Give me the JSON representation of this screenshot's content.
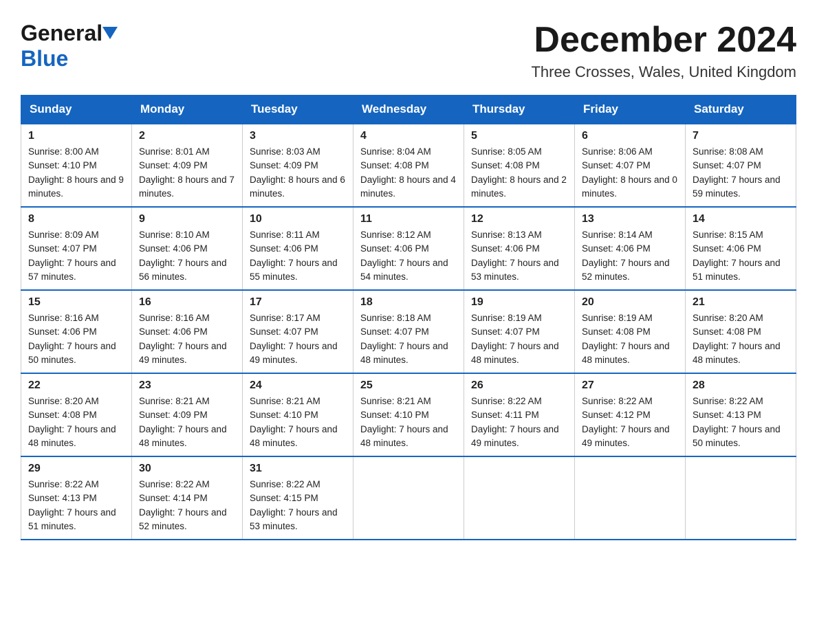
{
  "header": {
    "logo_general": "General",
    "logo_blue": "Blue",
    "month_title": "December 2024",
    "location": "Three Crosses, Wales, United Kingdom"
  },
  "days_of_week": [
    "Sunday",
    "Monday",
    "Tuesday",
    "Wednesday",
    "Thursday",
    "Friday",
    "Saturday"
  ],
  "weeks": [
    [
      {
        "day": "1",
        "sunrise": "8:00 AM",
        "sunset": "4:10 PM",
        "daylight": "8 hours and 9 minutes."
      },
      {
        "day": "2",
        "sunrise": "8:01 AM",
        "sunset": "4:09 PM",
        "daylight": "8 hours and 7 minutes."
      },
      {
        "day": "3",
        "sunrise": "8:03 AM",
        "sunset": "4:09 PM",
        "daylight": "8 hours and 6 minutes."
      },
      {
        "day": "4",
        "sunrise": "8:04 AM",
        "sunset": "4:08 PM",
        "daylight": "8 hours and 4 minutes."
      },
      {
        "day": "5",
        "sunrise": "8:05 AM",
        "sunset": "4:08 PM",
        "daylight": "8 hours and 2 minutes."
      },
      {
        "day": "6",
        "sunrise": "8:06 AM",
        "sunset": "4:07 PM",
        "daylight": "8 hours and 0 minutes."
      },
      {
        "day": "7",
        "sunrise": "8:08 AM",
        "sunset": "4:07 PM",
        "daylight": "7 hours and 59 minutes."
      }
    ],
    [
      {
        "day": "8",
        "sunrise": "8:09 AM",
        "sunset": "4:07 PM",
        "daylight": "7 hours and 57 minutes."
      },
      {
        "day": "9",
        "sunrise": "8:10 AM",
        "sunset": "4:06 PM",
        "daylight": "7 hours and 56 minutes."
      },
      {
        "day": "10",
        "sunrise": "8:11 AM",
        "sunset": "4:06 PM",
        "daylight": "7 hours and 55 minutes."
      },
      {
        "day": "11",
        "sunrise": "8:12 AM",
        "sunset": "4:06 PM",
        "daylight": "7 hours and 54 minutes."
      },
      {
        "day": "12",
        "sunrise": "8:13 AM",
        "sunset": "4:06 PM",
        "daylight": "7 hours and 53 minutes."
      },
      {
        "day": "13",
        "sunrise": "8:14 AM",
        "sunset": "4:06 PM",
        "daylight": "7 hours and 52 minutes."
      },
      {
        "day": "14",
        "sunrise": "8:15 AM",
        "sunset": "4:06 PM",
        "daylight": "7 hours and 51 minutes."
      }
    ],
    [
      {
        "day": "15",
        "sunrise": "8:16 AM",
        "sunset": "4:06 PM",
        "daylight": "7 hours and 50 minutes."
      },
      {
        "day": "16",
        "sunrise": "8:16 AM",
        "sunset": "4:06 PM",
        "daylight": "7 hours and 49 minutes."
      },
      {
        "day": "17",
        "sunrise": "8:17 AM",
        "sunset": "4:07 PM",
        "daylight": "7 hours and 49 minutes."
      },
      {
        "day": "18",
        "sunrise": "8:18 AM",
        "sunset": "4:07 PM",
        "daylight": "7 hours and 48 minutes."
      },
      {
        "day": "19",
        "sunrise": "8:19 AM",
        "sunset": "4:07 PM",
        "daylight": "7 hours and 48 minutes."
      },
      {
        "day": "20",
        "sunrise": "8:19 AM",
        "sunset": "4:08 PM",
        "daylight": "7 hours and 48 minutes."
      },
      {
        "day": "21",
        "sunrise": "8:20 AM",
        "sunset": "4:08 PM",
        "daylight": "7 hours and 48 minutes."
      }
    ],
    [
      {
        "day": "22",
        "sunrise": "8:20 AM",
        "sunset": "4:08 PM",
        "daylight": "7 hours and 48 minutes."
      },
      {
        "day": "23",
        "sunrise": "8:21 AM",
        "sunset": "4:09 PM",
        "daylight": "7 hours and 48 minutes."
      },
      {
        "day": "24",
        "sunrise": "8:21 AM",
        "sunset": "4:10 PM",
        "daylight": "7 hours and 48 minutes."
      },
      {
        "day": "25",
        "sunrise": "8:21 AM",
        "sunset": "4:10 PM",
        "daylight": "7 hours and 48 minutes."
      },
      {
        "day": "26",
        "sunrise": "8:22 AM",
        "sunset": "4:11 PM",
        "daylight": "7 hours and 49 minutes."
      },
      {
        "day": "27",
        "sunrise": "8:22 AM",
        "sunset": "4:12 PM",
        "daylight": "7 hours and 49 minutes."
      },
      {
        "day": "28",
        "sunrise": "8:22 AM",
        "sunset": "4:13 PM",
        "daylight": "7 hours and 50 minutes."
      }
    ],
    [
      {
        "day": "29",
        "sunrise": "8:22 AM",
        "sunset": "4:13 PM",
        "daylight": "7 hours and 51 minutes."
      },
      {
        "day": "30",
        "sunrise": "8:22 AM",
        "sunset": "4:14 PM",
        "daylight": "7 hours and 52 minutes."
      },
      {
        "day": "31",
        "sunrise": "8:22 AM",
        "sunset": "4:15 PM",
        "daylight": "7 hours and 53 minutes."
      },
      null,
      null,
      null,
      null
    ]
  ],
  "labels": {
    "sunrise": "Sunrise:",
    "sunset": "Sunset:",
    "daylight": "Daylight:"
  }
}
